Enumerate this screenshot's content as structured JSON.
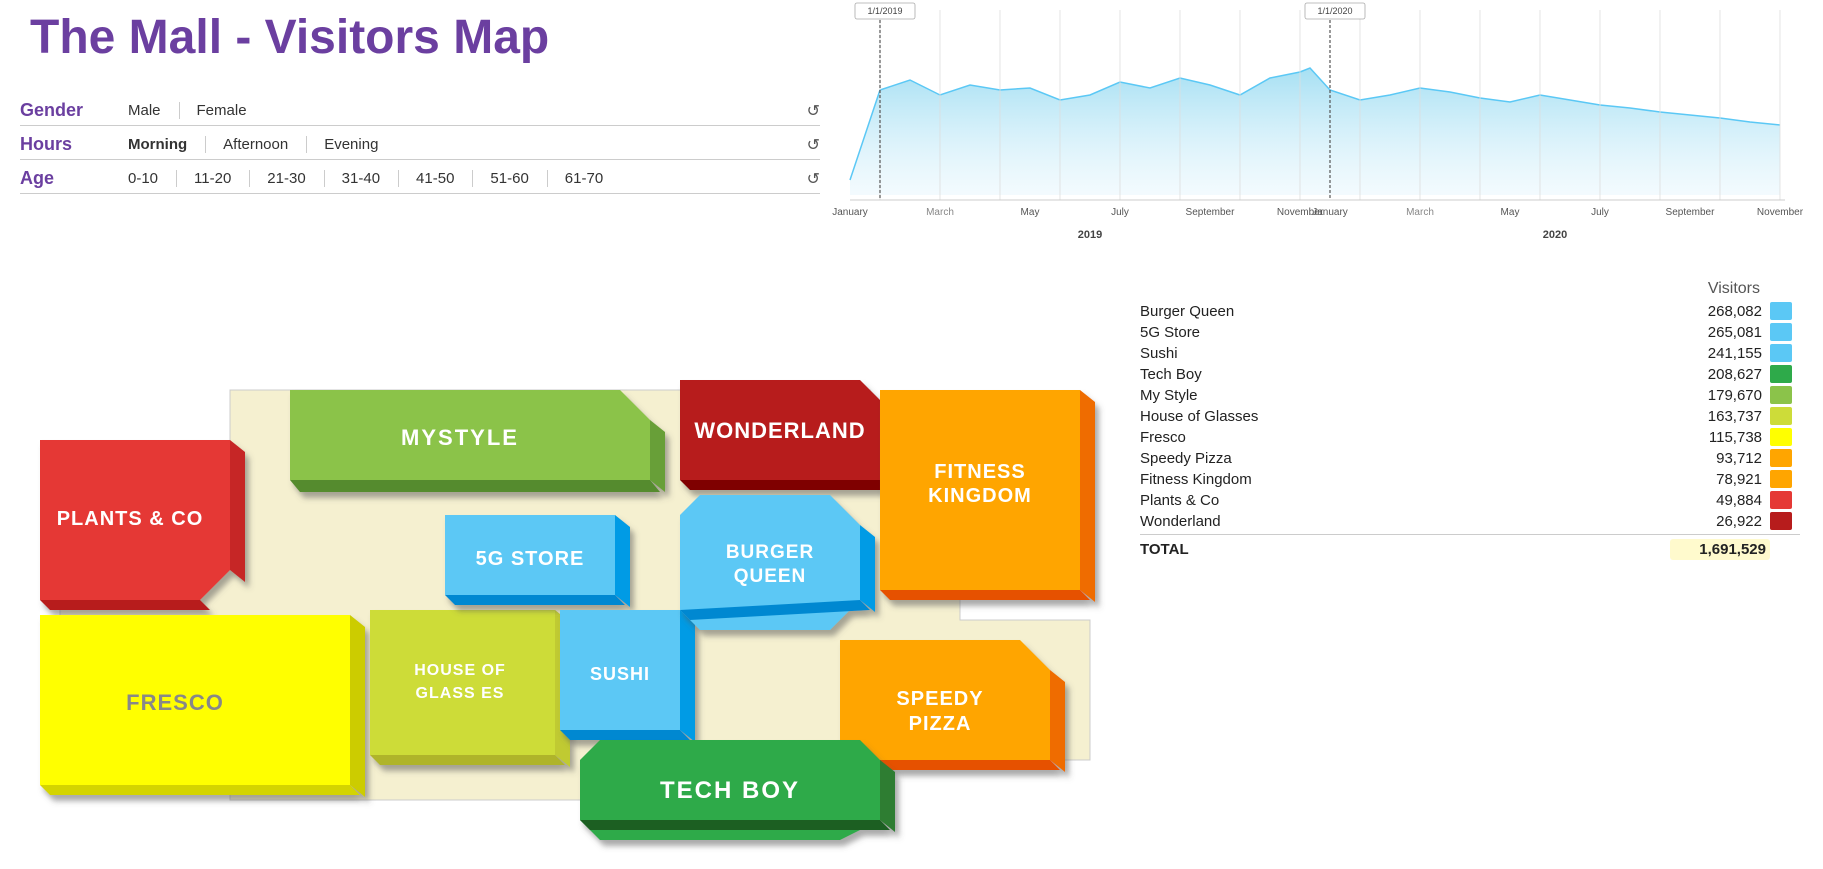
{
  "title": "The Mall - Visitors Map",
  "filters": {
    "gender": {
      "label": "Gender",
      "options": [
        "Male",
        "Female"
      ],
      "selected": null,
      "reset_icon": "↺"
    },
    "hours": {
      "label": "Hours",
      "options": [
        "Morning",
        "Afternoon",
        "Evening"
      ],
      "selected": "Morning",
      "reset_icon": "↺"
    },
    "age": {
      "label": "Age",
      "options": [
        "0-10",
        "11-20",
        "21-30",
        "31-40",
        "41-50",
        "51-60",
        "61-70"
      ],
      "selected": null,
      "reset_icon": "↺"
    }
  },
  "chart": {
    "x_labels_2019": [
      "January",
      "March",
      "May",
      "July",
      "September",
      "November"
    ],
    "x_labels_2020": [
      "January",
      "March",
      "May",
      "July",
      "September",
      "November"
    ],
    "year_labels": [
      "2019",
      "2020"
    ],
    "marker_2019": "1/1/2019",
    "marker_2020": "1/1/2020"
  },
  "stores": [
    {
      "name": "BURGER QUEEN",
      "color": "#5bc8f5",
      "visitors": 268082,
      "display": "268,082"
    },
    {
      "name": "5G STORE",
      "color": "#5bc8f5",
      "visitors": 265081,
      "display": "265,081"
    },
    {
      "name": "SUSHI",
      "color": "#5bc8f5",
      "visitors": 241155,
      "display": "241,155"
    },
    {
      "name": "TECH BOY",
      "color": "#2eaa4a",
      "visitors": 208627,
      "display": "208,627"
    },
    {
      "name": "MYSTYLE",
      "color": "#8bc34a",
      "visitors": 179670,
      "display": "179,670"
    },
    {
      "name": "HOUSE OF GLASSES",
      "color": "#cddc39",
      "visitors": 163737,
      "display": "163,737"
    },
    {
      "name": "FRESCO",
      "color": "#ffff00",
      "visitors": 115738,
      "display": "115,738"
    },
    {
      "name": "SPEEDY PIZZA",
      "color": "#ffa500",
      "visitors": 93712,
      "display": "93,712"
    },
    {
      "name": "FITNESS KINGDOM",
      "color": "#ffa500",
      "visitors": 78921,
      "display": "78,921"
    },
    {
      "name": "PLANTS & CO",
      "color": "#e53935",
      "visitors": 49884,
      "display": "49,884"
    },
    {
      "name": "WONDERLAND",
      "color": "#b71c1c",
      "visitors": 26922,
      "display": "26,922"
    }
  ],
  "legend": {
    "title": "Visitors",
    "rows": [
      {
        "name": "Burger Queen",
        "value": "268,082",
        "color": "#5bc8f5"
      },
      {
        "name": "5G Store",
        "value": "265,081",
        "color": "#5bc8f5"
      },
      {
        "name": "Sushi",
        "value": "241,155",
        "color": "#5bc8f5"
      },
      {
        "name": "Tech Boy",
        "value": "208,627",
        "color": "#2eaa4a"
      },
      {
        "name": "My Style",
        "value": "179,670",
        "color": "#8bc34a"
      },
      {
        "name": "House of Glasses",
        "value": "163,737",
        "color": "#cddc39"
      },
      {
        "name": "Fresco",
        "value": "115,738",
        "color": "#ffff00"
      },
      {
        "name": "Speedy Pizza",
        "value": "93,712",
        "color": "#ffa500"
      },
      {
        "name": "Fitness Kingdom",
        "value": "78,921",
        "color": "#ffa500"
      },
      {
        "name": "Plants & Co",
        "value": "49,884",
        "color": "#e53935"
      },
      {
        "name": "Wonderland",
        "value": "26,922",
        "color": "#b71c1c"
      }
    ],
    "total_label": "TOTAL",
    "total_value": "1,691,529"
  }
}
